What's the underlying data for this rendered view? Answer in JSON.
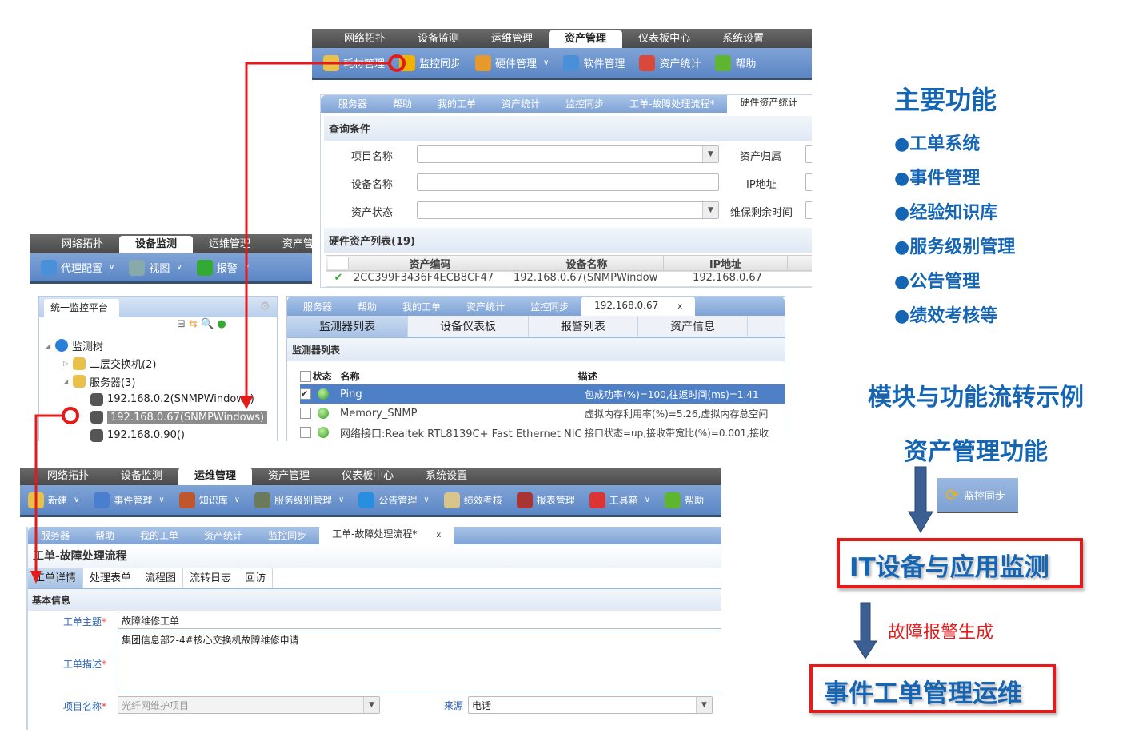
{
  "main_nav": [
    "网络拓扑",
    "设备监测",
    "运维管理",
    "资产管理",
    "仪表板中心",
    "系统设置"
  ],
  "asset_panel": {
    "active_nav": 3,
    "toolbar": [
      {
        "label": "耗材管理",
        "icon": "consumables-icon",
        "color": "#e8c04a"
      },
      {
        "label": "监控同步",
        "icon": "sync-icon",
        "color": "#f0b400"
      },
      {
        "label": "硬件管理",
        "icon": "hardware-icon",
        "color": "#e69a2e",
        "dropdown": true
      },
      {
        "label": "软件管理",
        "icon": "software-disc-icon",
        "color": "#4a90d9"
      },
      {
        "label": "资产统计",
        "icon": "chart-icon",
        "color": "#d9483b"
      },
      {
        "label": "帮助",
        "icon": "help-icon",
        "color": "#5fb530"
      }
    ],
    "tabs": [
      "服务器",
      "帮助",
      "我的工单",
      "资产统计",
      "监控同步",
      "工单-故障处理流程*",
      "硬件资产统计"
    ],
    "active_tab": 6,
    "query_title": "查询条件",
    "fields": {
      "project": "项目名称",
      "device": "设备名称",
      "status": "资产状态",
      "owner": "资产归属",
      "ip": "IP地址",
      "warranty": "维保剩余时间"
    },
    "list_title": "硬件资产列表(19)",
    "columns": [
      "资产编码",
      "设备名称",
      "IP地址"
    ],
    "rows": [
      {
        "checked": true,
        "code": "2CC399F3436F4ECB8CF47",
        "name": "192.168.0.67(SNMPWindow",
        "ip": "192.168.0.67"
      }
    ]
  },
  "monitor_panel": {
    "active_nav": 1,
    "toolbar": [
      {
        "label": "代理配置",
        "icon": "agent-config-icon",
        "color": "#4a90d9"
      },
      {
        "label": "视图",
        "icon": "view-icon",
        "color": "#8aa"
      },
      {
        "label": "报警",
        "icon": "alarm-icon",
        "color": "#3a3"
      }
    ],
    "tree_title": "统一监控平台",
    "tree": [
      {
        "label": "监测树",
        "level": 0,
        "icon": "globe-icon"
      },
      {
        "label": "二层交换机(2)",
        "level": 1,
        "icon": "folder-icon"
      },
      {
        "label": "服务器(3)",
        "level": 1,
        "icon": "folder-icon"
      },
      {
        "label": "192.168.0.2(SNMPWindows)",
        "level": 2,
        "icon": "server-icon"
      },
      {
        "label": "192.168.0.67(SNMPWindows)",
        "level": 2,
        "icon": "server-icon",
        "selected": true
      },
      {
        "label": "192.168.0.90()",
        "level": 2,
        "icon": "server-icon"
      }
    ],
    "tabs": [
      "服务器",
      "帮助",
      "我的工单",
      "资产统计",
      "监控同步",
      "192.168.0.67"
    ],
    "subtabs": [
      "监测器列表",
      "设备仪表板",
      "报警列表",
      "资产信息"
    ],
    "list_title": "监测器列表",
    "columns": [
      "状态",
      "名称",
      "描述"
    ],
    "rows": [
      {
        "checked": true,
        "name": "Ping",
        "desc": "包成功率(%)=100,往返时间(ms)=1.41",
        "selected": true
      },
      {
        "checked": false,
        "name": "Memory_SNMP",
        "desc": "虚拟内存利用率(%)=5.26,虚拟内存总空间"
      },
      {
        "checked": false,
        "name": "网络接口:Realtek RTL8139C+ Fast Ethernet NIC",
        "desc": "接口状态=up,接收带宽比(%)=0.001,接收"
      }
    ]
  },
  "ops_panel": {
    "active_nav": 2,
    "toolbar": [
      {
        "label": "新建",
        "icon": "new-icon",
        "color": "#e8c04a",
        "dropdown": true
      },
      {
        "label": "事件管理",
        "icon": "event-icon",
        "color": "#4a7fd0",
        "dropdown": true
      },
      {
        "label": "知识库",
        "icon": "books-icon",
        "color": "#c0562b",
        "dropdown": true
      },
      {
        "label": "服务级别管理",
        "icon": "service-level-icon",
        "color": "#6b7a5a",
        "dropdown": true
      },
      {
        "label": "公告管理",
        "icon": "info-icon",
        "color": "#2a8ee0",
        "dropdown": true
      },
      {
        "label": "绩效考核",
        "icon": "report-sheet-icon",
        "color": "#d8c58a"
      },
      {
        "label": "报表管理",
        "icon": "clipboard-icon",
        "color": "#a33"
      },
      {
        "label": "工具箱",
        "icon": "toolbox-icon",
        "color": "#d33",
        "dropdown": true
      },
      {
        "label": "帮助",
        "icon": "help-icon",
        "color": "#5fb530"
      }
    ],
    "tabs": [
      "服务器",
      "帮助",
      "我的工单",
      "资产统计",
      "监控同步",
      "工单-故障处理流程*"
    ],
    "title": "工单-故障处理流程",
    "subtabs": [
      "工单详情",
      "处理表单",
      "流程图",
      "流转日志",
      "回访"
    ],
    "section": "基本信息",
    "subject_label": "工单主题",
    "subject": "故障维修工单",
    "desc_label": "工单描述",
    "desc": "集团信息部2-4#核心交换机故障维修申请",
    "project_label": "项目名称",
    "project": "光纤网维护项目",
    "source_label": "来源",
    "source": "电话"
  },
  "right": {
    "features_title": "主要功能",
    "features": [
      "●工单系统",
      "●事件管理",
      "●经验知识库",
      "●服务级别管理",
      "●公告管理",
      "●绩效考核等"
    ],
    "flow_title": "模块与功能流转示例",
    "step1": "资产管理功能",
    "sync_button": "监控同步",
    "step2": "IT设备与应用监测",
    "alarm_label": "故障报警生成",
    "step3": "事件工单管理运维"
  },
  "colors": {
    "accent_blue": "#1565b5",
    "highlight_red": "#e41b1b",
    "toolbar_blue": "#6b93cc",
    "arrow_blue": "#3c5f93"
  }
}
